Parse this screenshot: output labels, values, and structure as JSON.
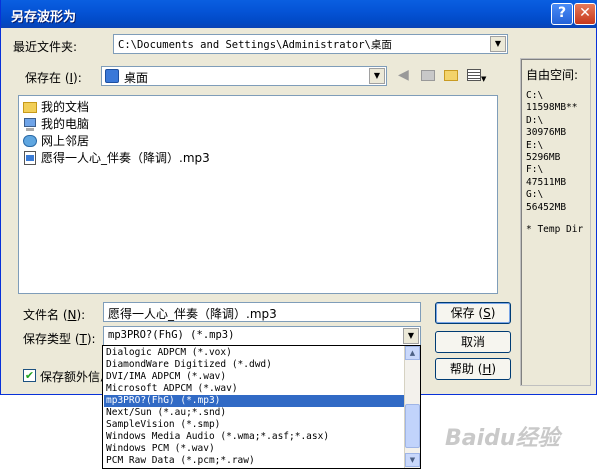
{
  "window": {
    "title": "另存波形为",
    "help_glyph": "?",
    "close_glyph": "✕"
  },
  "recent": {
    "label": "最近文件夹:",
    "value": "C:\\Documents and Settings\\Administrator\\桌面"
  },
  "save_in": {
    "label_prefix": "保存在 (",
    "label_key": "I",
    "label_suffix": "):",
    "value": "桌面"
  },
  "file_list": [
    {
      "name": "我的文档",
      "icon": "folder-icon"
    },
    {
      "name": "我的电脑",
      "icon": "computer-icon"
    },
    {
      "name": "网上邻居",
      "icon": "network-icon"
    },
    {
      "name": "愿得一人心_伴奏（降调）.mp3",
      "icon": "audio-file-icon"
    }
  ],
  "free_space": {
    "title": "自由空间:",
    "lines": [
      "C:\\",
      "11598MB**",
      "D:\\",
      "30976MB",
      "E:\\",
      "5296MB",
      "F:\\",
      "47511MB",
      "G:\\",
      "56452MB"
    ],
    "temp": "* Temp Dir"
  },
  "filename": {
    "label_prefix": "文件名 (",
    "label_key": "N",
    "label_suffix": "):",
    "value": "愿得一人心_伴奏（降调）.mp3"
  },
  "filetype": {
    "label_prefix": "保存类型 (",
    "label_key": "T",
    "label_suffix": "):",
    "value": "mp3PRO?(FhG) (*.mp3)"
  },
  "buttons": {
    "save_prefix": "保存 (",
    "save_key": "S",
    "save_suffix": ")",
    "cancel": "取消",
    "help_prefix": "帮助 (",
    "help_key": "H",
    "help_suffix": ")"
  },
  "checkbox": {
    "label": "保存额外信息",
    "checked": true
  },
  "type_options": [
    "Dialogic ADPCM (*.vox)",
    "DiamondWare Digitized (*.dwd)",
    "DVI/IMA ADPCM (*.wav)",
    "Microsoft ADPCM (*.wav)",
    "mp3PRO?(FhG) (*.mp3)",
    "Next/Sun (*.au;*.snd)",
    "SampleVision (*.smp)",
    "Windows Media Audio (*.wma;*.asf;*.asx)",
    "Windows PCM (*.wav)",
    "PCM Raw Data (*.pcm;*.raw)"
  ],
  "selected_option_index": 4,
  "watermark": "Baidu经验"
}
